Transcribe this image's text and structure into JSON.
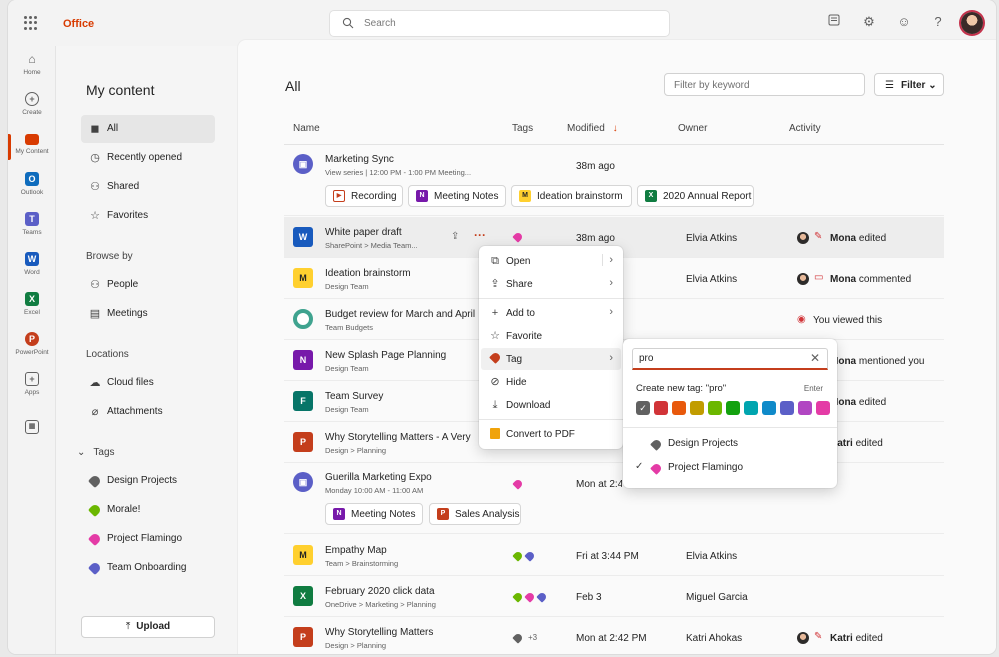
{
  "topbar": {
    "brand": "Office",
    "search_placeholder": "Search"
  },
  "rail": [
    {
      "label": "Home",
      "icon": "home-icon"
    },
    {
      "label": "Create",
      "icon": "create-icon"
    },
    {
      "label": "My Content",
      "icon": "folder-icon"
    },
    {
      "label": "Outlook",
      "icon": "outlook-icon"
    },
    {
      "label": "Teams",
      "icon": "teams-icon"
    },
    {
      "label": "Word",
      "icon": "word-icon"
    },
    {
      "label": "Excel",
      "icon": "excel-icon"
    },
    {
      "label": "PowerPoint",
      "icon": "powerpoint-icon"
    },
    {
      "label": "Apps",
      "icon": "apps-icon"
    }
  ],
  "nav": {
    "title": "My content",
    "items": [
      "All",
      "Recently opened",
      "Shared",
      "Favorites"
    ],
    "browse_label": "Browse by",
    "browse": [
      "People",
      "Meetings"
    ],
    "locations_label": "Locations",
    "locations": [
      "Cloud files",
      "Attachments"
    ],
    "tags_label": "Tags",
    "tags": [
      {
        "name": "Design Projects",
        "color": "#616161"
      },
      {
        "name": "Morale!",
        "color": "#6bb700"
      },
      {
        "name": "Project Flamingo",
        "color": "#e43ba6"
      },
      {
        "name": "Team Onboarding",
        "color": "#5b5fc7"
      }
    ],
    "upload": "Upload"
  },
  "main": {
    "title": "All",
    "filter_placeholder": "Filter by keyword",
    "filter_button": "Filter",
    "columns": {
      "name": "Name",
      "tags": "Tags",
      "modified": "Modified",
      "owner": "Owner",
      "activity": "Activity"
    }
  },
  "rows": [
    {
      "name": "Marketing Sync",
      "sub": "View series | 12:00 PM - 1:00 PM Meeting...",
      "modified": "38m ago",
      "owner": "",
      "activity": ""
    },
    {
      "name": "White paper draft",
      "sub": "SharePoint > Media Team...",
      "modified": "38m ago",
      "owner": "Elvia Atkins",
      "activity_user": "Mona",
      "activity": "edited"
    },
    {
      "name": "Ideation brainstorm",
      "sub": "Design Team",
      "modified": "",
      "owner": "Elvia Atkins",
      "activity_user": "Mona",
      "activity": "commented"
    },
    {
      "name": "Budget review for March and April",
      "sub": "Team Budgets",
      "modified": "",
      "owner": "",
      "activity": "You viewed this"
    },
    {
      "name": "New Splash Page Planning",
      "sub": "Design Team",
      "modified": "",
      "owner": "",
      "activity_user": "Mona",
      "activity": "mentioned you"
    },
    {
      "name": "Team Survey",
      "sub": "Design Team",
      "modified": "",
      "owner": "",
      "activity_user": "Mona",
      "activity": "edited"
    },
    {
      "name": "Why Storytelling Matters - A Very Long Title",
      "sub": "Design > Planning",
      "modified": "",
      "owner": "",
      "activity_user": "Katri",
      "activity": "edited"
    },
    {
      "name": "Guerilla Marketing Expo",
      "sub": "Monday 10:00 AM - 11:00 AM",
      "modified": "Mon at 2:42 PM",
      "owner": "",
      "activity": ""
    },
    {
      "name": "Empathy Map",
      "sub": "Team > Brainstorming",
      "modified": "Fri at 3:44 PM",
      "owner": "Elvia  Atkins",
      "activity": ""
    },
    {
      "name": "February 2020 click data",
      "sub": "OneDrive > Marketing > Planning",
      "modified": "Feb 3",
      "owner": "Miguel Garcia",
      "activity": ""
    },
    {
      "name": "Why Storytelling Matters",
      "sub": "Design > Planning",
      "modified": "Mon at 2:42 PM",
      "owner": "Katri Ahokas",
      "activity_user": "Katri",
      "activity": "edited"
    }
  ],
  "chips_sync": [
    "Recording",
    "Meeting Notes",
    "Ideation brainstorm",
    "2020 Annual Report"
  ],
  "chips_expo": [
    "Meeting Notes",
    "Sales Analysis"
  ],
  "more_tags": "+3",
  "context_menu": [
    "Open",
    "Share",
    "Add to",
    "Favorite",
    "Tag",
    "Hide",
    "Download",
    "Convert to PDF"
  ],
  "tag_flyout": {
    "value": "pro",
    "create_label": "Create new tag: \"pro\"",
    "enter_hint": "Enter",
    "swatches": [
      "#616161",
      "#d13438",
      "#e8590c",
      "#c19c00",
      "#6bb700",
      "#13a10e",
      "#00a5af",
      "#0f8ac9",
      "#5b5fc7",
      "#b146c2",
      "#e43ba6"
    ],
    "options": [
      {
        "name": "Design Projects",
        "color": "#616161",
        "checked": false
      },
      {
        "name": "Project Flamingo",
        "color": "#e43ba6",
        "checked": true
      }
    ]
  }
}
